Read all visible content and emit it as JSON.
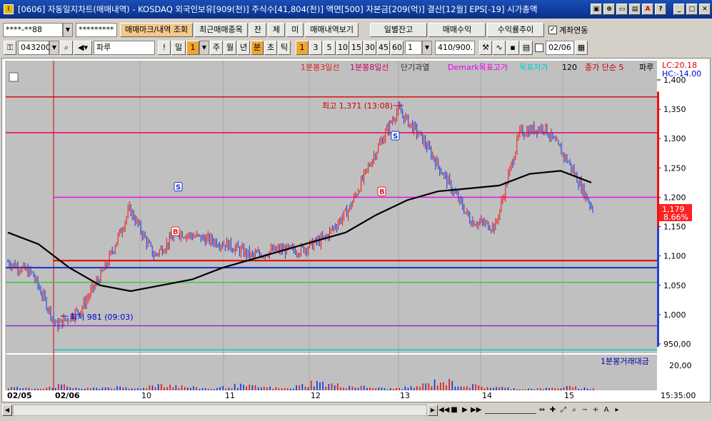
{
  "window": {
    "title": "[0606] 자동일지차트(매매내역) - KOSDAQ 외국인보유[909(천)] 주식수[41,804(천)] 액면[500] 자본금[209(억)] 결산[12월] EPS[-19] 시가총액",
    "app_icon": "I"
  },
  "toolbar1": {
    "account_value": "****-**88",
    "password_value": "*********",
    "buttons": [
      "매매마크/내역 조회",
      "최근매매종목",
      "잔",
      "체",
      "미",
      "매매내역보기"
    ],
    "right_buttons": [
      "일별잔고",
      "매매수익",
      "수익률추이"
    ],
    "link_label": "계좌연동",
    "link_checked": true
  },
  "toolbar2": {
    "code": "043200",
    "name": "파루",
    "period_buttons": [
      "일",
      "1",
      "주",
      "월",
      "년",
      "분",
      "초",
      "틱"
    ],
    "minute_buttons": [
      "1",
      "3",
      "5",
      "10",
      "15",
      "30",
      "45",
      "60"
    ],
    "interval_value": "1",
    "count_value": "410/900.",
    "date_value": "02/06"
  },
  "colors": {
    "ma3": "#dd2222",
    "ma8": "#cc0066",
    "ma120": "#000000",
    "up": "#ee1111",
    "down": "#1133dd",
    "demark": "#ee00ee",
    "target": "#00cccc",
    "bg": "#c0c0c0"
  },
  "legend": {
    "ma3": "1분봉3일선",
    "ma8": "1분봉8일선",
    "trend": "단기과열",
    "demark": "Demark목표고가",
    "target": "목표저가",
    "period": "120",
    "close": "종가 단순 5",
    "name": "파루"
  },
  "price_panel": {
    "lc": "LC:20.18",
    "hc": "HC:-14.00",
    "current_price": "1,179",
    "change_pct": "8.66%",
    "high_label": "최고 1,371 (13:08)",
    "low_label": "최저 981 (09:03)",
    "y_ticks": [
      "1,400",
      "1,350",
      "1,300",
      "1,250",
      "1,200",
      "1,150",
      "1,100",
      "1,050",
      "1,000",
      "950,00"
    ],
    "markers": [
      "S",
      "B",
      "S",
      "B"
    ]
  },
  "volume_panel": {
    "label": "1분봉거래대금",
    "y_tick": "20,00"
  },
  "x_axis": {
    "labels": [
      "02/05",
      "02/06",
      "10",
      "11",
      "12",
      "13",
      "14",
      "15"
    ],
    "time_label": "15:35:00"
  },
  "chart_data": [
    {
      "type": "line",
      "xlabel": "",
      "ylabel": "",
      "ylim": [
        950,
        1400
      ],
      "x": [
        "02/05",
        "02/06",
        "10",
        "11",
        "12",
        "13",
        "14",
        "15"
      ],
      "series": [
        {
          "name": "파루",
          "values": [
            1090,
            1070,
            981,
            1010,
            1080,
            1180,
            1100,
            1140,
            1130,
            1120,
            1100,
            1110,
            1110,
            1130,
            1180,
            1270,
            1350,
            1300,
            1230,
            1160,
            1150,
            1310,
            1320,
            1260,
            1180
          ]
        },
        {
          "name": "120",
          "values": [
            1140,
            1120,
            1080,
            1050,
            1040,
            1050,
            1060,
            1080,
            1095,
            1110,
            1125,
            1140,
            1170,
            1195,
            1210,
            1215,
            1220,
            1240,
            1245,
            1225
          ]
        }
      ],
      "hlines": [
        1371,
        1310,
        1200,
        1092,
        1080,
        1055,
        981,
        940
      ]
    },
    {
      "type": "bar",
      "xlabel": "",
      "ylabel": "",
      "ylim": [
        0,
        20
      ],
      "series": [
        {
          "name": "1분봉거래대금",
          "values": [
            2,
            1,
            3,
            1,
            2,
            1,
            4,
            2,
            1,
            3,
            2,
            1,
            5,
            3,
            2,
            1,
            2,
            6,
            3,
            2,
            1,
            1,
            2,
            1
          ]
        }
      ]
    }
  ]
}
